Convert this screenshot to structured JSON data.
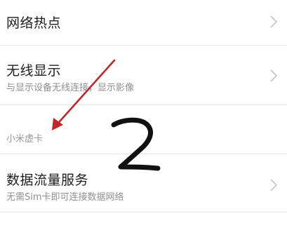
{
  "settings": {
    "hotspot": {
      "title": "网络热点",
      "icon": "chevron-right-icon"
    },
    "wireless_display": {
      "title": "无线显示",
      "subtitle": "与显示设备无线连接，显示影像",
      "icon": "chevron-right-icon"
    },
    "section_header": "小米虚卡",
    "data_service": {
      "title": "数据流量服务",
      "subtitle": "无需Sim卡即可连接数据网络",
      "icon": "chevron-right-icon"
    }
  },
  "annotation": {
    "step_number": "2",
    "arrow_color": "#c0282a",
    "ink_color": "#111111"
  }
}
